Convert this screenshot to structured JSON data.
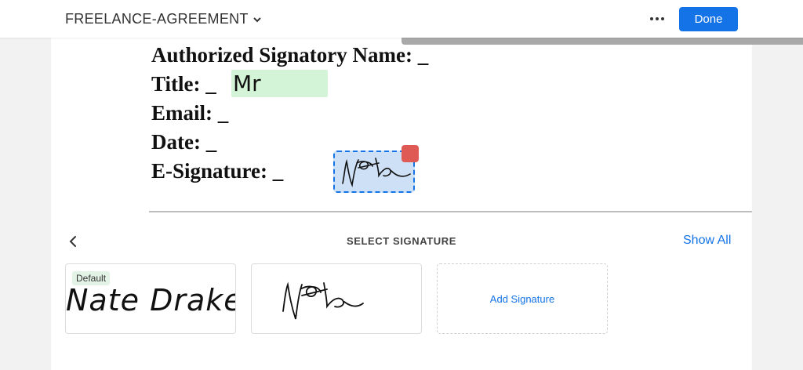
{
  "header": {
    "doc_title": "FREELANCE-AGREEMENT",
    "more_icon": "more-horizontal-icon",
    "done_label": "Done"
  },
  "document": {
    "lines": [
      "Authorized Signatory Name: _",
      "Title: _",
      "Email: _",
      "Date: _",
      "E-Signature: _"
    ],
    "title_field_value": "Mr"
  },
  "panel": {
    "title": "SELECT SIGNATURE",
    "show_all_label": "Show All",
    "back_icon": "chevron-left-icon",
    "cards": {
      "default_badge": "Default",
      "typed_signature": "Nate Drake",
      "add_label": "Add Signature"
    }
  },
  "colors": {
    "accent": "#1473e6",
    "field_green": "#d3f4d7",
    "signature_field": "#cde0f5",
    "delete_red": "#e05a55"
  }
}
